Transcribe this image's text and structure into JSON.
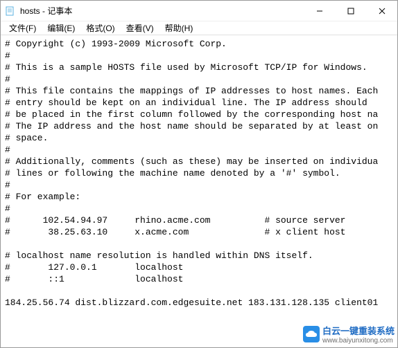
{
  "titlebar": {
    "title": "hosts - 记事本"
  },
  "menu": {
    "file": "文件(F)",
    "edit": "编辑(E)",
    "format": "格式(O)",
    "view": "查看(V)",
    "help": "帮助(H)"
  },
  "content": {
    "lines": [
      "# Copyright (c) 1993-2009 Microsoft Corp.",
      "#",
      "# This is a sample HOSTS file used by Microsoft TCP/IP for Windows.",
      "#",
      "# This file contains the mappings of IP addresses to host names. Each",
      "# entry should be kept on an individual line. The IP address should",
      "# be placed in the first column followed by the corresponding host na",
      "# The IP address and the host name should be separated by at least on",
      "# space.",
      "#",
      "# Additionally, comments (such as these) may be inserted on individua",
      "# lines or following the machine name denoted by a '#' symbol.",
      "#",
      "# For example:",
      "#",
      "#      102.54.94.97     rhino.acme.com          # source server",
      "#       38.25.63.10     x.acme.com              # x client host",
      "",
      "# localhost name resolution is handled within DNS itself.",
      "#       127.0.0.1       localhost",
      "#       ::1             localhost",
      "",
      "184.25.56.74 dist.blizzard.com.edgesuite.net 183.131.128.135 client01"
    ]
  },
  "watermark": {
    "text": "白云一键重装系统",
    "url": "www.baiyunxitong.com"
  }
}
